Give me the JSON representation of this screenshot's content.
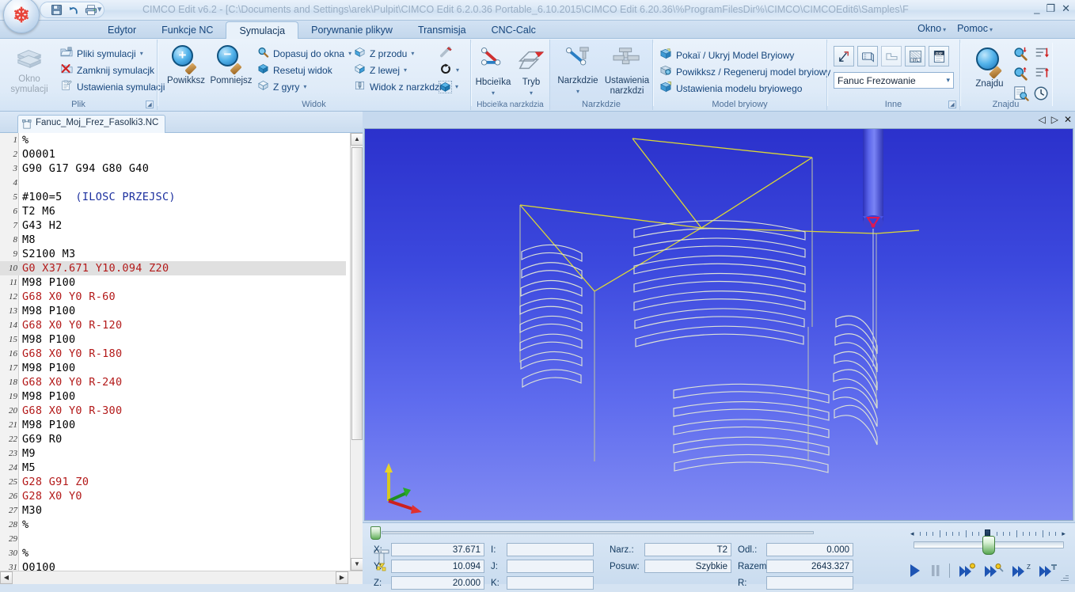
{
  "window": {
    "title": "CIMCO Edit v6.2 - [C:\\Documents and Settings\\arek\\Pulpit\\CIMCO Edit 6.2.0.36 Portable_6.10.2015\\CIMCO Edit 6.20.36\\%ProgramFilesDir%\\CIMCO\\CIMCOEdit6\\Samples\\F",
    "minimize": "_",
    "restore": "❐",
    "close": "✕",
    "quick_access": [
      "save-icon",
      "undo-icon",
      "print-icon",
      "customize-icon"
    ]
  },
  "ribbon_tabs": [
    {
      "label": "Edytor",
      "active": false
    },
    {
      "label": "Funkcje NC",
      "active": false
    },
    {
      "label": "Symulacja",
      "active": true
    },
    {
      "label": "Porywnanie plikyw",
      "active": false
    },
    {
      "label": "Transmisja",
      "active": false
    },
    {
      "label": "CNC-Calc",
      "active": false
    }
  ],
  "menus": [
    {
      "label": "Okno"
    },
    {
      "label": "Pomoc"
    }
  ],
  "ribbon_groups": [
    {
      "name": "Plik",
      "title": "Plik",
      "big_button": {
        "label_line1": "Okno",
        "label_line2": "symulacji",
        "icon": "simulation-window-icon"
      },
      "items": [
        {
          "label": "Pliki symulacji",
          "icon": "files-icon",
          "dropdown": true
        },
        {
          "label": "Zamknij symulacjk",
          "icon": "close-sim-icon",
          "dropdown": false
        },
        {
          "label": "Ustawienia symulacji",
          "icon": "settings-icon",
          "dropdown": false
        }
      ],
      "has_dialog_launcher": true
    },
    {
      "name": "Widok",
      "title": "Widok",
      "big_buttons": [
        {
          "label": "Powikksz",
          "icon": "zoom-in-icon"
        },
        {
          "label": "Pomniejsz",
          "icon": "zoom-out-icon"
        }
      ],
      "items_col1": [
        {
          "label": "Dopasuj do okna",
          "icon": "fit-window-icon",
          "dropdown": true
        },
        {
          "label": "Resetuj widok",
          "icon": "reset-view-icon",
          "dropdown": false
        },
        {
          "label": "Z gyry",
          "icon": "top-view-icon",
          "dropdown": true
        }
      ],
      "items_col2": [
        {
          "label": "Z przodu",
          "icon": "front-view-icon",
          "dropdown": true
        },
        {
          "label": "Z lewej",
          "icon": "left-view-icon",
          "dropdown": true
        },
        {
          "label": "Widok z narzkdzia",
          "icon": "tool-view-icon",
          "dropdown": false
        }
      ],
      "items_col3": [
        {
          "label": "",
          "icon": "measure-icon",
          "dropdown": false
        },
        {
          "label": "",
          "icon": "rotate-icon",
          "dropdown": true
        },
        {
          "label": "",
          "icon": "shade-icon",
          "dropdown": true
        }
      ]
    },
    {
      "name": "Hbcieika narzkdzia",
      "title": "Hbcieïka narzkdzia",
      "big_buttons": [
        {
          "label": "Hbcieïka",
          "icon": "toolpath-icon",
          "dropdown": true
        },
        {
          "label": "Tryb",
          "icon": "mode-icon",
          "dropdown": true
        }
      ]
    },
    {
      "name": "Narzkdzie",
      "title": "Narzkdzie",
      "big_buttons": [
        {
          "label": "Narzkdzie",
          "icon": "tool-icon",
          "dropdown": true
        },
        {
          "label_line1": "Ustawienia",
          "label_line2": "narzkdzi",
          "icon": "tool-settings-icon"
        }
      ]
    },
    {
      "name": "Model bryiowy",
      "title": "Model bryiowy",
      "items": [
        {
          "label": "Pokaï / Ukryj Model Bryiowy",
          "icon": "show-solid-icon"
        },
        {
          "label": "Powikksz / Regeneruj model bryiowy",
          "icon": "regen-solid-icon"
        },
        {
          "label": "Ustawienia modelu bryiowego",
          "icon": "solid-settings-icon"
        }
      ]
    },
    {
      "name": "Inne",
      "title": "Inne",
      "icon_buttons": [
        "export-icon",
        "render-icon",
        "window-icon",
        "stl-icon",
        "dxf-icon"
      ],
      "dropdown_value": "Fanuc Frezowanie",
      "has_dialog_launcher": true
    },
    {
      "name": "Znajdu",
      "title": "Znajdu",
      "big_button": {
        "label": "Znajdu",
        "icon": "find-icon"
      },
      "icon_buttons": [
        "find-next-icon",
        "goto-start-icon",
        "find-prev-icon",
        "goto-end-icon",
        "find-list-icon",
        "find-time-icon"
      ]
    }
  ],
  "editor": {
    "file_tab": "Fanuc_Moj_Frez_Fasolki3.NC",
    "file_icon": "nc-file-icon",
    "selected_line": 10,
    "lines": [
      {
        "n": 1,
        "text": "%",
        "color": "black"
      },
      {
        "n": 2,
        "text": "O0001",
        "color": "black"
      },
      {
        "n": 3,
        "text": "G90 G17 G94 G80 G40",
        "color": "black"
      },
      {
        "n": 4,
        "text": "",
        "color": "black"
      },
      {
        "n": 5,
        "text": "#100=5  (ILOSC PRZEJSC)",
        "color": "mixed",
        "code": "#100=5",
        "comment": "(ILOSC PRZEJSC)"
      },
      {
        "n": 6,
        "text": "T2 M6",
        "color": "black"
      },
      {
        "n": 7,
        "text": "G43 H2",
        "color": "black"
      },
      {
        "n": 8,
        "text": "M8",
        "color": "black"
      },
      {
        "n": 9,
        "text": "S2100 M3",
        "color": "black"
      },
      {
        "n": 10,
        "text": "G0 X37.671 Y10.094 Z20",
        "color": "red"
      },
      {
        "n": 11,
        "text": "M98 P100",
        "color": "black"
      },
      {
        "n": 12,
        "text": "G68 X0 Y0 R-60",
        "color": "red"
      },
      {
        "n": 13,
        "text": "M98 P100",
        "color": "black"
      },
      {
        "n": 14,
        "text": "G68 X0 Y0 R-120",
        "color": "red"
      },
      {
        "n": 15,
        "text": "M98 P100",
        "color": "black"
      },
      {
        "n": 16,
        "text": "G68 X0 Y0 R-180",
        "color": "red"
      },
      {
        "n": 17,
        "text": "M98 P100",
        "color": "black"
      },
      {
        "n": 18,
        "text": "G68 X0 Y0 R-240",
        "color": "red"
      },
      {
        "n": 19,
        "text": "M98 P100",
        "color": "black"
      },
      {
        "n": 20,
        "text": "G68 X0 Y0 R-300",
        "color": "red"
      },
      {
        "n": 21,
        "text": "M98 P100",
        "color": "black"
      },
      {
        "n": 22,
        "text": "G69 R0",
        "color": "black"
      },
      {
        "n": 23,
        "text": "M9",
        "color": "black"
      },
      {
        "n": 24,
        "text": "M5",
        "color": "black"
      },
      {
        "n": 25,
        "text": "G28 G91 Z0",
        "color": "red"
      },
      {
        "n": 26,
        "text": "G28 X0 Y0",
        "color": "red"
      },
      {
        "n": 27,
        "text": "M30",
        "color": "black"
      },
      {
        "n": 28,
        "text": "%",
        "color": "black"
      },
      {
        "n": 29,
        "text": "",
        "color": "black"
      },
      {
        "n": 30,
        "text": "%",
        "color": "black"
      },
      {
        "n": 31,
        "text": "O0100",
        "color": "black"
      }
    ]
  },
  "viewport": {
    "nav_buttons": [
      "prev-icon",
      "next-icon",
      "close-icon"
    ],
    "axis_indicator": {
      "x_color": "#e02020",
      "y_color": "#22a022",
      "z_color": "#e8d428"
    },
    "toolpath_color": "#e8ecd8",
    "rapid_color": "#e8e22a",
    "tool_color": "#4048e0",
    "background_top": "#2d33cf",
    "background_bottom": "#7d87f2"
  },
  "status": {
    "tool_icon": "milling-tool-icon",
    "fields": [
      {
        "label": "X:",
        "value": "37.671"
      },
      {
        "label": "Y:",
        "value": "10.094"
      },
      {
        "label": "Z:",
        "value": "20.000"
      },
      {
        "label": "I:",
        "value": ""
      },
      {
        "label": "J:",
        "value": ""
      },
      {
        "label": "K:",
        "value": ""
      },
      {
        "label": "Narz.:",
        "value": "T2"
      },
      {
        "label": "Posuw:",
        "value": "Szybkie"
      },
      {
        "label": "Odl.:",
        "value": "0.000"
      },
      {
        "label": "Razem:",
        "value": "2643.327"
      },
      {
        "label": "R:",
        "value": ""
      }
    ]
  },
  "playback": {
    "buttons": [
      {
        "name": "play-button",
        "glyph": "▶"
      },
      {
        "name": "pause-button",
        "glyph": "‖"
      },
      {
        "name": "step-block-button",
        "glyph": "▶▶"
      },
      {
        "name": "step-tool-button",
        "glyph": "▶▶"
      },
      {
        "name": "step-z-button",
        "glyph": "▶▶"
      },
      {
        "name": "step-toolchange-button",
        "glyph": "▶▶"
      }
    ]
  }
}
